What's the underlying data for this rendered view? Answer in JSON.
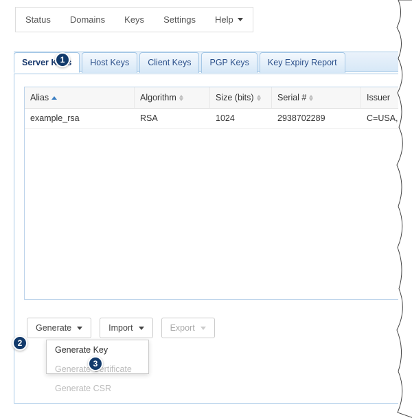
{
  "top_nav": {
    "items": [
      {
        "label": "Status"
      },
      {
        "label": "Domains"
      },
      {
        "label": "Keys"
      },
      {
        "label": "Settings"
      },
      {
        "label": "Help",
        "has_dropdown": true
      }
    ]
  },
  "tabs": [
    {
      "label": "Server Keys",
      "active": true
    },
    {
      "label": "Host Keys"
    },
    {
      "label": "Client Keys"
    },
    {
      "label": "PGP Keys"
    },
    {
      "label": "Key Expiry Report"
    }
  ],
  "table": {
    "columns": [
      {
        "label": "Alias",
        "sorted": "asc"
      },
      {
        "label": "Algorithm"
      },
      {
        "label": "Size (bits)"
      },
      {
        "label": "Serial #"
      },
      {
        "label": "Issuer"
      }
    ],
    "rows": [
      {
        "alias": "example_rsa",
        "algorithm": "RSA",
        "size": "1024",
        "serial": "2938702289",
        "issuer": "C=USA,"
      }
    ]
  },
  "actions": {
    "generate": "Generate",
    "import": "Import",
    "export": "Export"
  },
  "generate_menu": {
    "items": [
      {
        "label": "Generate Key",
        "enabled": true
      },
      {
        "label": "Generate Certificate",
        "enabled": false
      },
      {
        "label": "Generate CSR",
        "enabled": false
      }
    ]
  },
  "callouts": {
    "1": "1",
    "2": "2",
    "3": "3"
  }
}
